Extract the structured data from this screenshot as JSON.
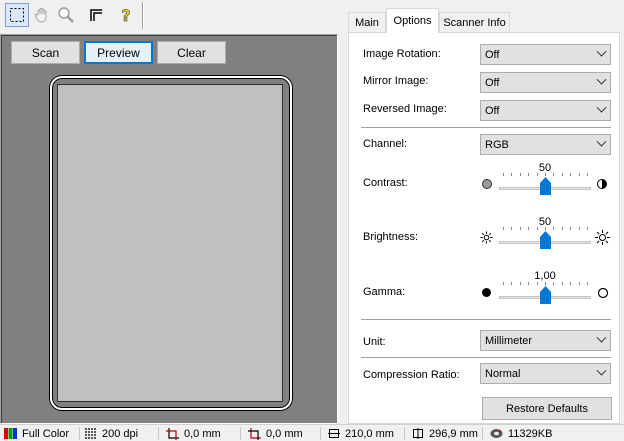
{
  "toolbar": {
    "tools": [
      {
        "name": "marquee-select-icon",
        "active": true
      },
      {
        "name": "hand-pan-icon",
        "active": false
      },
      {
        "name": "zoom-magnifier-icon",
        "active": false
      },
      {
        "name": "corner-origin-icon",
        "active": false
      },
      {
        "name": "help-question-icon",
        "active": false
      }
    ]
  },
  "preview": {
    "scan_label": "Scan",
    "preview_label": "Preview",
    "clear_label": "Clear"
  },
  "tabs": [
    {
      "label": "Main",
      "selected": false
    },
    {
      "label": "Options",
      "selected": true
    },
    {
      "label": "Scanner Info",
      "selected": false
    }
  ],
  "options": {
    "image_rotation": {
      "label": "Image Rotation:",
      "value": "Off"
    },
    "mirror_image": {
      "label": "Mirror Image:",
      "value": "Off"
    },
    "reversed_image": {
      "label": "Reversed Image:",
      "value": "Off"
    },
    "channel": {
      "label": "Channel:",
      "value": "RGB"
    },
    "contrast": {
      "label": "Contrast:",
      "value": "50",
      "fraction": 0.5
    },
    "brightness": {
      "label": "Brightness:",
      "value": "50",
      "fraction": 0.5
    },
    "gamma": {
      "label": "Gamma:",
      "value": "1,00",
      "fraction": 0.5
    },
    "unit": {
      "label": "Unit:",
      "value": "Millimeter"
    },
    "compression_ratio": {
      "label": "Compression Ratio:",
      "value": "Normal"
    },
    "restore_label": "Restore Defaults"
  },
  "status": {
    "color_mode": "Full Color",
    "resolution": "200 dpi",
    "x_offset": "0,0 mm",
    "y_offset": "0,0 mm",
    "width": "210,0 mm",
    "height": "296,9 mm",
    "size": "11329KB"
  },
  "colors": {
    "accent": "#0078d7",
    "preview_bg": "#808080",
    "paper": "#c0c0c0"
  }
}
